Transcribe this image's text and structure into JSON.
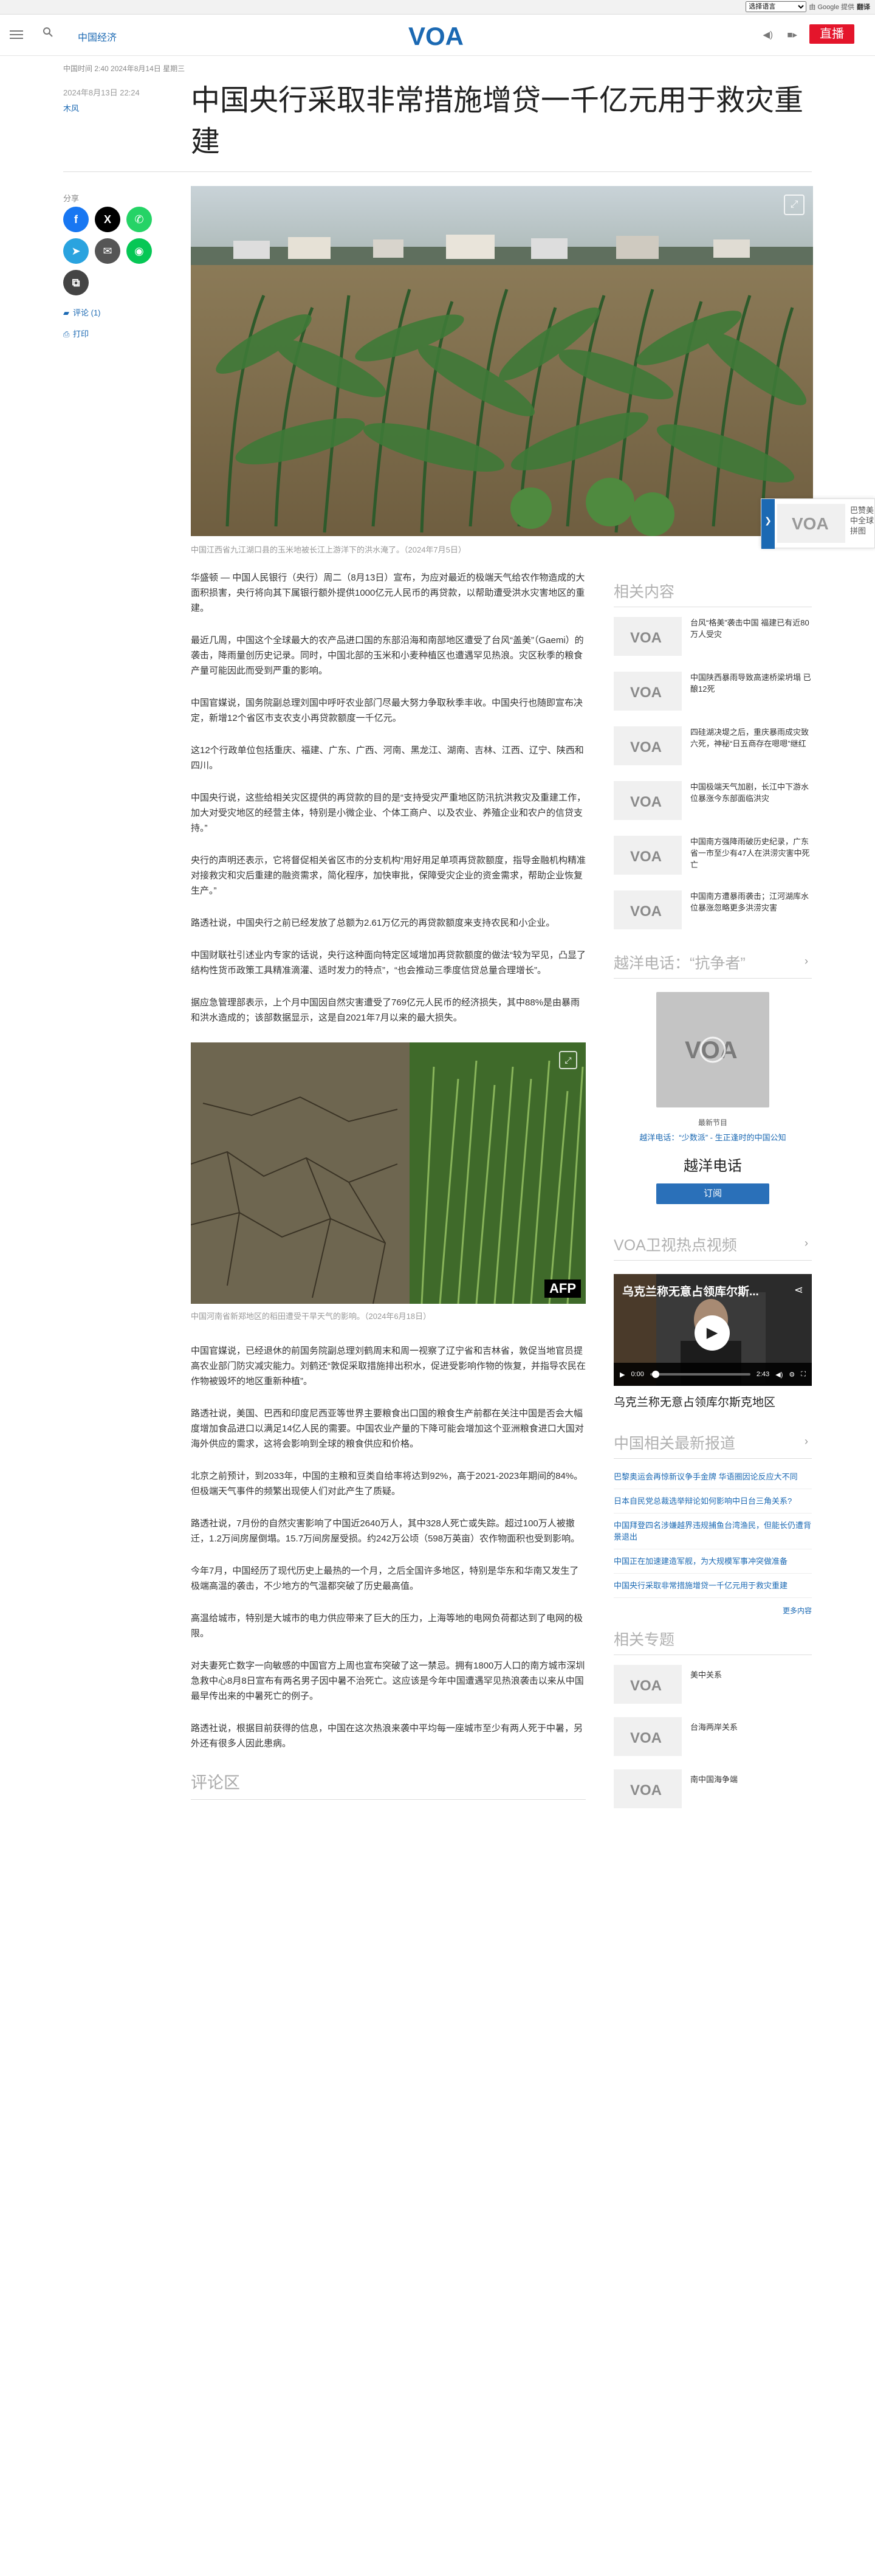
{
  "translate": {
    "select_label": "选择语言",
    "powered": "由 Google 提供",
    "google": "Go ogle",
    "translate_label": "翻译"
  },
  "header": {
    "section": "中国经济",
    "logo_text": "VOA",
    "live": "直播"
  },
  "article": {
    "meta": "中国时间 2:40 2024年8月14日 星期三",
    "date": "2024年8月13日 22:24",
    "author": "木风",
    "title": "中国央行采取非常措施增贷一千亿元用于救灾重建",
    "hero_caption": "中国江西省九江湖口县的玉米地被长江上游洋下的洪水淹了。（2024年7月5日）",
    "paragraphs": [
      "华盛顿 — 中国人民银行（央行）周二（8月13日）宣布，为应对最近的极端天气给农作物造成的大面积损害，央行将向其下属银行额外提供1000亿元人民币的再贷款，以帮助遭受洪水灾害地区的重建。",
      "最近几周，中国这个全球最大的农产品进口国的东部沿海和南部地区遭受了台风“盖美”（Gaemi）的袭击，降雨量创历史记录。同时，中国北部的玉米和小麦种植区也遭遇罕见热浪。灾区秋季的粮食产量可能因此而受到严重的影响。",
      "中国官媒说，国务院副总理刘国中呼吁农业部门尽最大努力争取秋季丰收。中国央行也随即宣布决定，新增12个省区市支农支小再贷款额度一千亿元。",
      "这12个行政单位包括重庆、福建、广东、广西、河南、黑龙江、湖南、吉林、江西、辽宁、陕西和四川。",
      "中国央行说，这些给相关灾区提供的再贷款的目的是“支持受灾严重地区防汛抗洪救灾及重建工作，加大对受灾地区的经营主体，特别是小微企业、个体工商户、以及农业、养殖企业和农户的信贷支持。”",
      "央行的声明还表示，它将督促相关省区市的分支机构“用好用足单项再贷款额度，指导金融机构精准对接救灾和灾后重建的融资需求，简化程序，加快审批，保障受灾企业的资金需求，帮助企业恢复生产。”",
      "路透社说，中国央行之前已经发放了总额为2.61万亿元的再贷款额度来支持农民和小企业。",
      "中国财联社引述业内专家的话说，央行这种面向特定区域增加再贷款额度的做法“较为罕见，凸显了结构性货币政策工具精准滴灌、适时发力的特点”，“也会推动三季度信贷总量合理增长”。",
      "据应急管理部表示，上个月中国因自然灾害遭受了769亿元人民币的经济损失，其中88%是由暴雨和洪水造成的；该部数据显示，这是自2021年7月以来的最大损失。"
    ],
    "inline_caption": "中国河南省新郑地区的稻田遭受干旱天气的影响。（2024年6月18日）",
    "afp": "AFP",
    "paragraphs2": [
      "中国官媒说，已经退休的前国务院副总理刘鹤周末和周一视察了辽宁省和吉林省，敦促当地官员提高农业部门防灾减灾能力。刘鹤还“敦促采取措施排出积水，促进受影响作物的恢复，并指导农民在作物被毁坏的地区重新种植”。",
      "路透社说，美国、巴西和印度尼西亚等世界主要粮食出口国的粮食生产前都在关注中国是否会大幅度增加食品进口以满足14亿人民的需要。中国农业产量的下降可能会增加这个亚洲粮食进口大国对海外供应的需求，这将会影响到全球的粮食供应和价格。",
      "北京之前预计，到2033年，中国的主粮和豆类自给率将达到92%，高于2021-2023年期间的84%。但极端天气事件的频繁出现使人们对此产生了质疑。",
      "路透社说，7月份的自然灾害影响了中国近2640万人，其中328人死亡或失踪。超过100万人被撤迁，1.2万间房屋倒塌。15.7万间房屋受损。约242万公顷（598万英亩）农作物面积也受到影响。",
      "今年7月，中国经历了现代历史上最热的一个月，之后全国许多地区，特别是华东和华南又发生了极端高温的袭击，不少地方的气温都突破了历史最高值。",
      "高温给城市，特别是大城市的电力供应带来了巨大的压力，上海等地的电网负荷都达到了电网的极限。",
      "对夫妻死亡数字一向敏感的中国官方上周也宣布突破了这一禁忌。拥有1800万人口的南方城市深圳急救中心8月8日宣布有两名男子因中暑不治死亡。这应该是今年中国遭遇罕见热浪袭击以来从中国最早传出来的中暑死亡的例子。",
      "路透社说，根据目前获得的信息，中国在这次热浪来袭中平均每一座城市至少有两人死于中暑，另外还有很多人因此患病。"
    ],
    "comments_heading": "评论区"
  },
  "share": {
    "label": "分享",
    "comment": "评论 (1)",
    "print": "打印"
  },
  "rail": {
    "text": "巴赞美中全球拼图"
  },
  "sidebar": {
    "related_heading": "相关内容",
    "related": [
      "台风“格美”袭击中国 福建已有近80万人受灾",
      "中国陕西暴雨导致高速桥梁坍塌 已酿12死",
      "四硅湖决堤之后，重庆暴雨成灾致六死，神秘“日五商存在嗯嗯”继红",
      "中国极端天气加剧，长江中下游水位暴涨今东部面临洪灾",
      "中国南方强降雨破历史纪录，广东省一市至少有47人在洪涝灾害中死亡",
      "中国南方遭暴雨袭击；江河湖库水位暴涨忽略更多洪涝灾害"
    ],
    "phone_heading": "越洋电话：“抗争者”",
    "phone_label": "最新节目",
    "phone_sub": "越洋电话：“少数派” - 生正逢时的中国公知",
    "phone_name": "越洋电话",
    "phone_subscribe": "订阅",
    "video_heading": "VOA卫视热点视频",
    "video_title": "乌克兰称无意占领库尔斯...",
    "video_time_start": "0:00",
    "video_time_end": "2:43",
    "video_caption": "乌克兰称无意占领库尔斯克地区",
    "news_heading": "中国相关最新报道",
    "news": [
      "巴黎奥运会再惊新议争手金牌 华语圈因论反应大不同",
      "日本自民党总裁选举辩论如何影响中日台三角关系?",
      "中国拜登四名涉嫌越界违规捕鱼台湾渔民，但能长仍遭背景退出",
      "中国正在加速建造军舰，为大规模军事冲突做准备",
      "中国央行采取非常措施增贷一千亿元用于救灾重建"
    ],
    "more": "更多内容",
    "topics_heading": "相关专题",
    "topics": [
      "美中关系",
      "台海两岸关系",
      "南中国海争端"
    ]
  },
  "colors": {
    "brand": "#1b69b3",
    "live": "#e4152b"
  }
}
